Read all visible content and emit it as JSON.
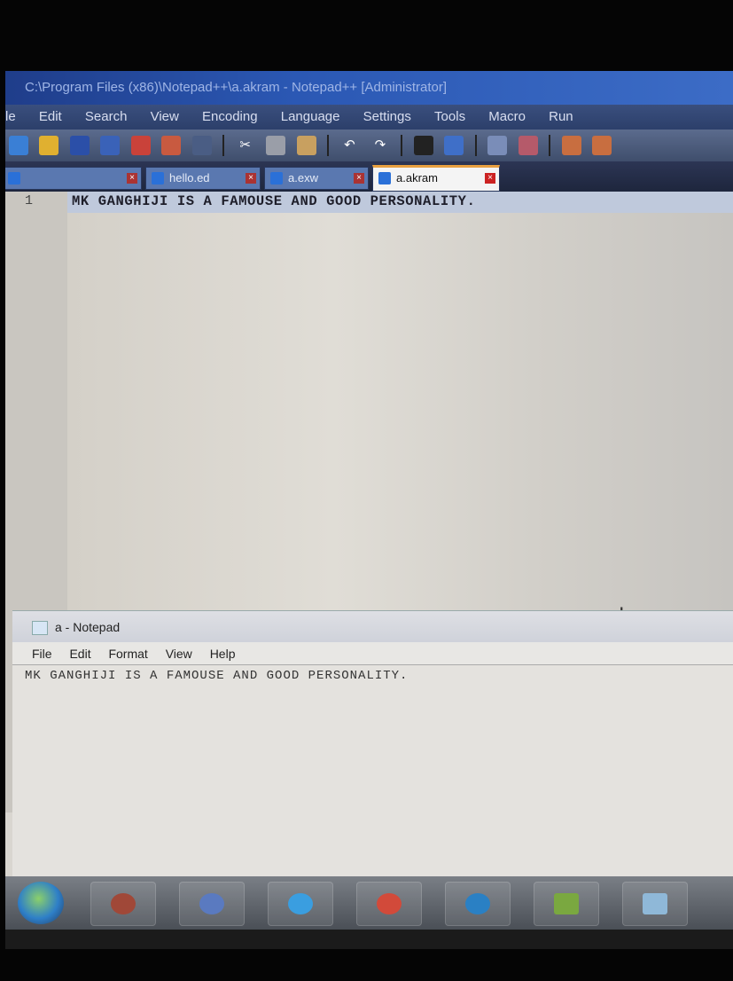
{
  "npp": {
    "title": "C:\\Program Files (x86)\\Notepad++\\a.akram - Notepad++ [Administrator]",
    "menu": [
      "le",
      "Edit",
      "Search",
      "View",
      "Encoding",
      "Language",
      "Settings",
      "Tools",
      "Macro",
      "Run"
    ],
    "tabs": [
      {
        "label": "",
        "active": false
      },
      {
        "label": "hello.ed",
        "active": false
      },
      {
        "label": "a.exw",
        "active": false
      },
      {
        "label": "a.akram",
        "active": true
      }
    ],
    "line_number": "1",
    "line_text": "MK GANGHIJI IS A FAMOUSE AND GOOD PERSONALITY."
  },
  "notepad": {
    "title": "a - Notepad",
    "menu": [
      "File",
      "Edit",
      "Format",
      "View",
      "Help"
    ],
    "text": "MK GANGHIJI IS A FAMOUSE AND GOOD PERSONALITY."
  },
  "taskbar": {
    "buttons": [
      "start-icon",
      "media-icon",
      "network-icon",
      "ie-icon",
      "music-icon",
      "chrome-icon",
      "notepadpp-icon",
      "notepad-icon"
    ]
  },
  "colors": {
    "titlebar": "#2b58b4",
    "active_tab_accent": "#e8a040"
  }
}
